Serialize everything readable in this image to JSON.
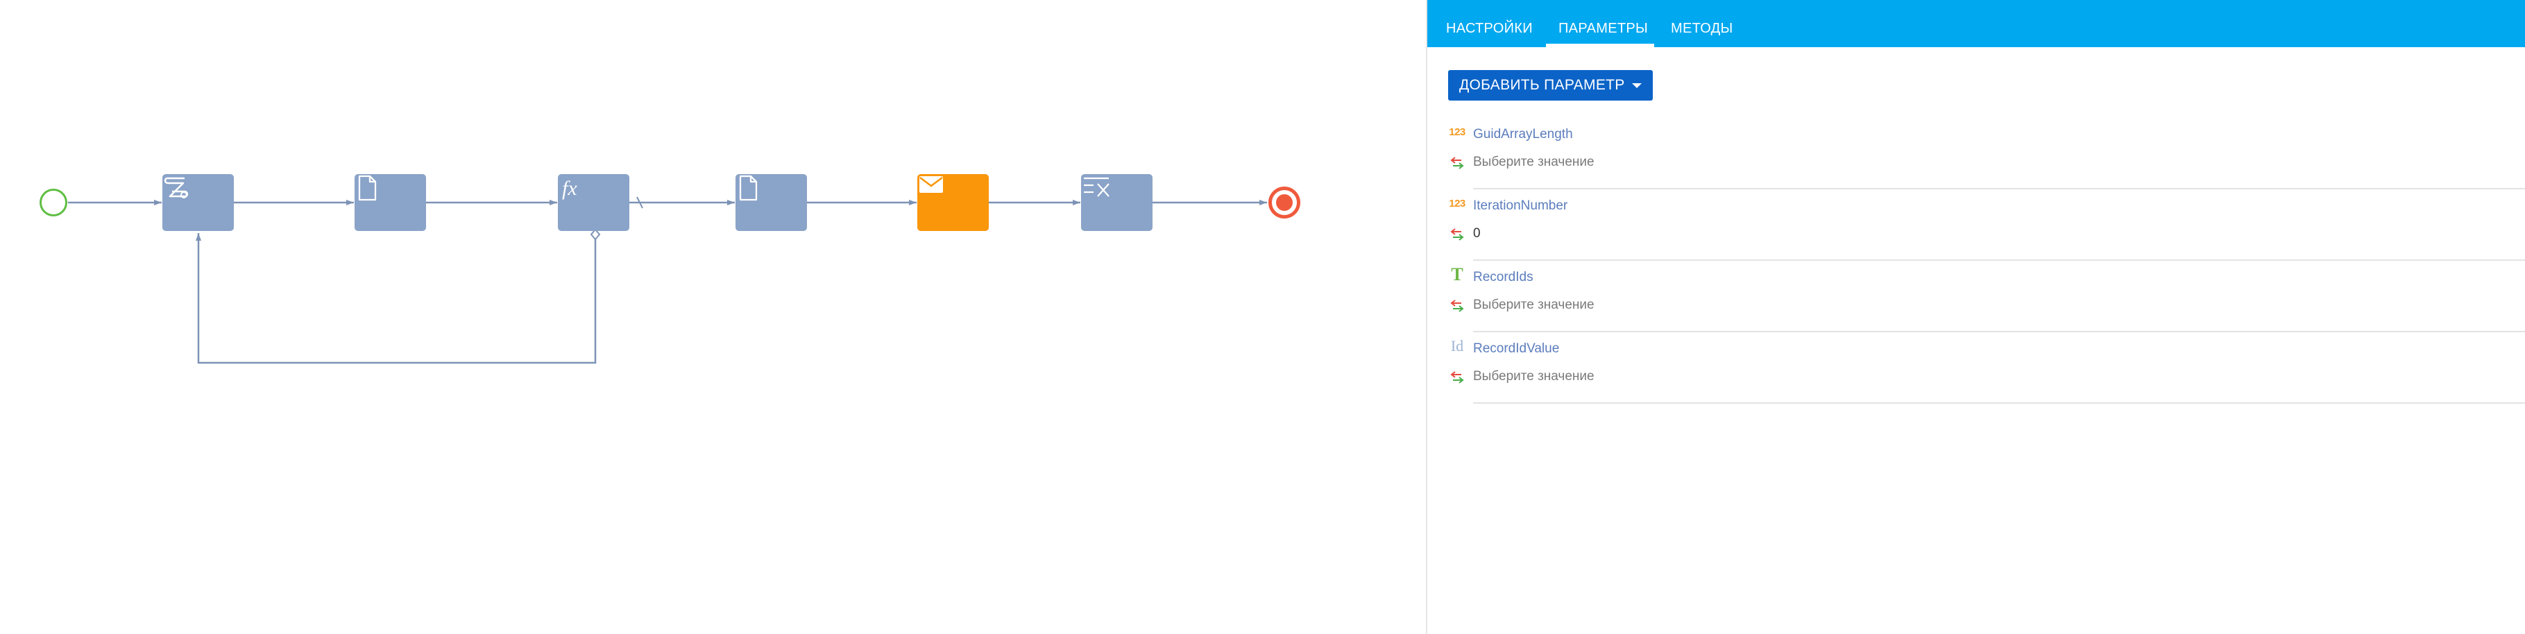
{
  "tabs": [
    {
      "label": "НАСТРОЙКИ",
      "active": false
    },
    {
      "label": "ПАРАМЕТРЫ",
      "active": true
    },
    {
      "label": "МЕТОДЫ",
      "active": false
    }
  ],
  "add_button": {
    "label": "ДОБАВИТЬ ПАРАМЕТР"
  },
  "parameters": [
    {
      "name": "GuidArrayLength",
      "type_icon": "integer-type-icon",
      "type_glyph": "123",
      "value": "Выберите значение",
      "value_is_placeholder": true
    },
    {
      "name": "IterationNumber",
      "type_icon": "integer-type-icon",
      "type_glyph": "123",
      "value": "0",
      "value_is_placeholder": false
    },
    {
      "name": "RecordIds",
      "type_icon": "text-type-icon",
      "type_glyph": "T",
      "value": "Выберите значение",
      "value_is_placeholder": true
    },
    {
      "name": "RecordIdValue",
      "type_icon": "id-type-icon",
      "type_glyph": "Id",
      "value": "Выберите значение",
      "value_is_placeholder": true
    }
  ],
  "process": {
    "elements": [
      {
        "kind": "start-event",
        "icon": "start-event-icon"
      },
      {
        "kind": "script-task",
        "icon": "script-icon"
      },
      {
        "kind": "user-task",
        "icon": "document-icon"
      },
      {
        "kind": "formula",
        "icon": "formula-icon",
        "glyph": "fx"
      },
      {
        "kind": "user-task",
        "icon": "document-icon"
      },
      {
        "kind": "send-email",
        "icon": "envelope-icon"
      },
      {
        "kind": "delete-data",
        "icon": "delete-data-icon"
      },
      {
        "kind": "end-event",
        "icon": "end-event-icon"
      }
    ]
  },
  "colors": {
    "tab_bar": "#00a8f0",
    "primary_button": "#0b63c7",
    "task_node": "#8aa3c8",
    "email_node": "#f9960a",
    "start_event": "#5fbe43",
    "end_event": "#f05a3c",
    "flow_line": "#7d93b5",
    "param_name": "#5b7dbd"
  }
}
